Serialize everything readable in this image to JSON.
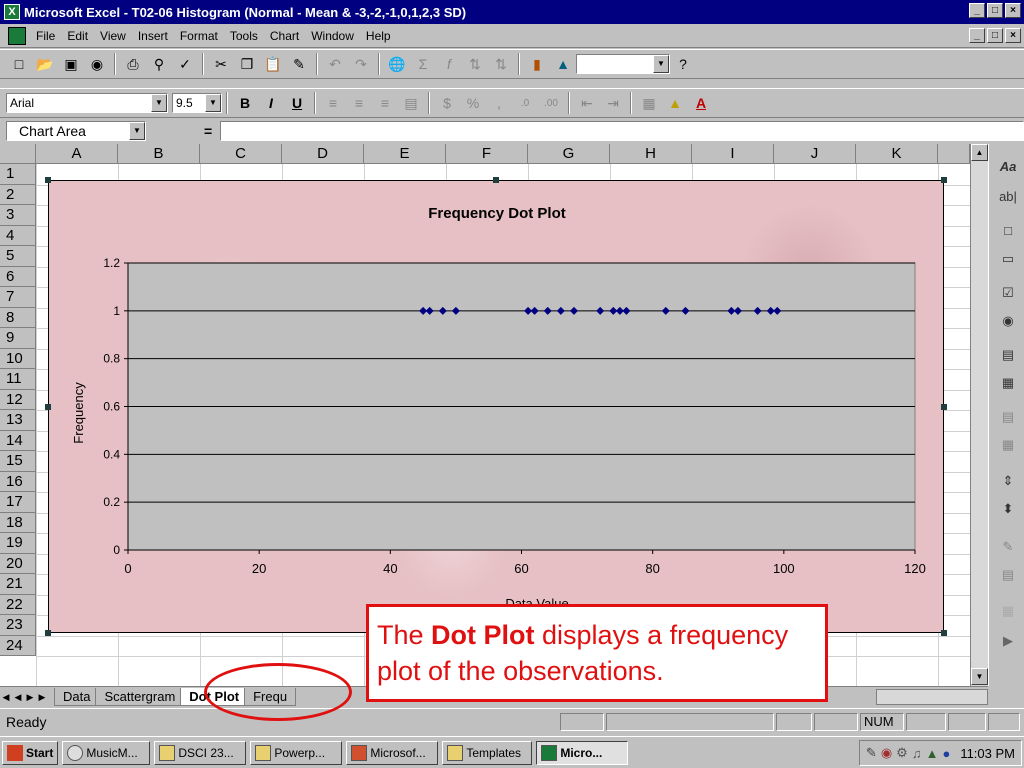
{
  "window": {
    "title": "Microsoft Excel - T02-06 Histogram (Normal - Mean & -3,-2,-1,0,1,2,3 SD)",
    "min": "_",
    "max": "□",
    "close": "×"
  },
  "menu": [
    "File",
    "Edit",
    "View",
    "Insert",
    "Format",
    "Tools",
    "Chart",
    "Window",
    "Help"
  ],
  "formatting": {
    "font": "Arial",
    "size": "9.5"
  },
  "formula_bar": {
    "name_box": "Chart Area",
    "equals": "="
  },
  "columns": [
    "A",
    "B",
    "C",
    "D",
    "E",
    "F",
    "G",
    "H",
    "I",
    "J",
    "K"
  ],
  "rows": [
    "1",
    "2",
    "3",
    "4",
    "5",
    "6",
    "7",
    "8",
    "9",
    "10",
    "11",
    "12",
    "13",
    "14",
    "15",
    "16",
    "17",
    "18",
    "19",
    "20",
    "21",
    "22",
    "23",
    "24"
  ],
  "chart_data": {
    "type": "scatter",
    "title": "Frequency Dot Plot",
    "xlabel": "Data Value",
    "ylabel": "Frequency",
    "xlim": [
      0,
      120
    ],
    "ylim": [
      0,
      1.2
    ],
    "xticks": [
      "0",
      "20",
      "40",
      "60",
      "80",
      "100",
      "120"
    ],
    "yticks": [
      "0",
      "0.2",
      "0.4",
      "0.6",
      "0.8",
      "1",
      "1.2"
    ],
    "grid": true,
    "series": [
      {
        "x": [
          45,
          46,
          48,
          50,
          61,
          62,
          64,
          66,
          68,
          72,
          74,
          75,
          76,
          82,
          85,
          92,
          93,
          96,
          98,
          99
        ],
        "y": [
          1,
          1,
          1,
          1,
          1,
          1,
          1,
          1,
          1,
          1,
          1,
          1,
          1,
          1,
          1,
          1,
          1,
          1,
          1,
          1
        ]
      }
    ],
    "plot_bg": "#c0c0c0",
    "marker_color": "#000080"
  },
  "sheet_tabs": [
    "Data",
    "Scattergram",
    "Dot Plot",
    "Frequ"
  ],
  "active_tab": "Dot Plot",
  "status": {
    "text": "Ready",
    "num": "NUM"
  },
  "callout": {
    "bold": "Dot Plot",
    "pre": "The ",
    "post": " displays a frequency plot of the observations."
  },
  "taskbar": {
    "start": "Start",
    "items": [
      "MusicM...",
      "DSCI 23...",
      "Powerp...",
      "Microsof...",
      "Templates",
      "Micro..."
    ],
    "clock": "11:03 PM"
  },
  "colors": {
    "chart_area": "#e6c0c4",
    "plot_area": "#c0c0c0",
    "highlight": "#e01010",
    "title_bar": "#000080"
  }
}
